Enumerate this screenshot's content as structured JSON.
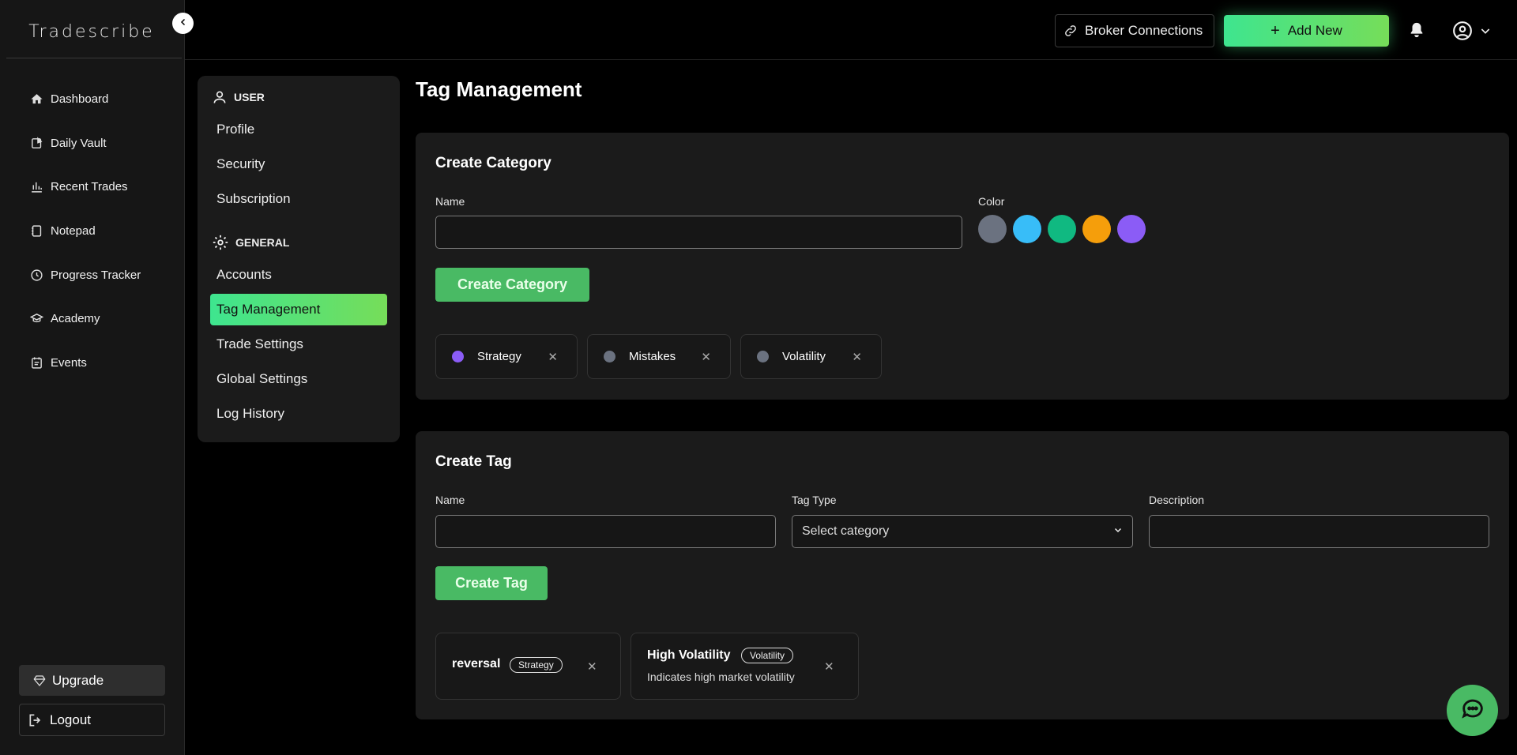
{
  "app": {
    "brand": "Tradescribe"
  },
  "sidebar": {
    "items": [
      {
        "label": "Dashboard",
        "icon": "home-icon"
      },
      {
        "label": "Daily Vault",
        "icon": "vault-icon"
      },
      {
        "label": "Recent Trades",
        "icon": "bar-chart-icon"
      },
      {
        "label": "Notepad",
        "icon": "notepad-icon"
      },
      {
        "label": "Progress Tracker",
        "icon": "clock-icon"
      },
      {
        "label": "Academy",
        "icon": "graduation-cap-icon"
      },
      {
        "label": "Events",
        "icon": "calendar-icon"
      }
    ],
    "upgrade": "Upgrade",
    "logout": "Logout"
  },
  "topbar": {
    "broker": "Broker Connections",
    "add_new": "Add New"
  },
  "settings": {
    "user_head": "USER",
    "user_items": [
      "Profile",
      "Security",
      "Subscription"
    ],
    "general_head": "GENERAL",
    "general_items": [
      "Accounts",
      "Tag Management",
      "Trade Settings",
      "Global Settings",
      "Log History"
    ],
    "active": "Tag Management"
  },
  "page": {
    "title": "Tag Management"
  },
  "category": {
    "title": "Create Category",
    "name_label": "Name",
    "name_value": "",
    "color_label": "Color",
    "colors": [
      "#6b7280",
      "#38bdf8",
      "#10b981",
      "#f59e0b",
      "#8b5cf6"
    ],
    "button": "Create Category",
    "chips": [
      {
        "label": "Strategy",
        "color": "#8b5cf6"
      },
      {
        "label": "Mistakes",
        "color": "#6b7280"
      },
      {
        "label": "Volatility",
        "color": "#6b7280"
      }
    ]
  },
  "tag": {
    "title": "Create Tag",
    "name_label": "Name",
    "name_value": "",
    "type_label": "Tag Type",
    "type_value": "Select category",
    "desc_label": "Description",
    "desc_value": "",
    "button": "Create Tag",
    "tags": [
      {
        "name": "reversal",
        "category": "Strategy",
        "description": ""
      },
      {
        "name": "High Volatility",
        "category": "Volatility",
        "description": "Indicates high market volatility"
      }
    ]
  }
}
